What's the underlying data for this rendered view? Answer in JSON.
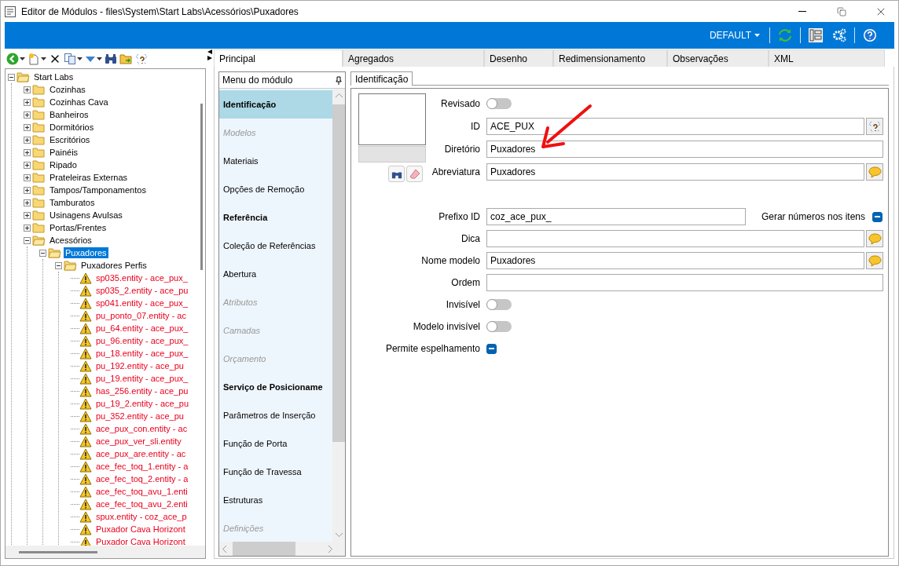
{
  "window": {
    "title": "Editor de Módulos - files\\System\\Start Labs\\Acessórios\\Puxadores"
  },
  "header": {
    "profile": "DEFAULT"
  },
  "tree": [
    {
      "label": "Start Labs",
      "kind": "folder",
      "expanded": true,
      "selected": false,
      "children": [
        {
          "label": "Cozinhas",
          "kind": "folder",
          "expanded": false,
          "selected": false
        },
        {
          "label": "Cozinhas Cava",
          "kind": "folder",
          "expanded": false,
          "selected": false
        },
        {
          "label": "Banheiros",
          "kind": "folder",
          "expanded": false,
          "selected": false
        },
        {
          "label": "Dormitórios",
          "kind": "folder",
          "expanded": false,
          "selected": false
        },
        {
          "label": "Escritórios",
          "kind": "folder",
          "expanded": false,
          "selected": false
        },
        {
          "label": "Painéis",
          "kind": "folder",
          "expanded": false,
          "selected": false
        },
        {
          "label": "Ripado",
          "kind": "folder",
          "expanded": false,
          "selected": false
        },
        {
          "label": "Prateleiras Externas",
          "kind": "folder",
          "expanded": false,
          "selected": false
        },
        {
          "label": "Tampos/Tamponamentos",
          "kind": "folder",
          "expanded": false,
          "selected": false
        },
        {
          "label": "Tamburatos",
          "kind": "folder",
          "expanded": false,
          "selected": false
        },
        {
          "label": "Usinagens Avulsas",
          "kind": "folder",
          "expanded": false,
          "selected": false
        },
        {
          "label": "Portas/Frentes",
          "kind": "folder",
          "expanded": false,
          "selected": false
        },
        {
          "label": "Acessórios",
          "kind": "folder",
          "expanded": true,
          "selected": false,
          "children": [
            {
              "label": "Puxadores",
              "kind": "folder",
              "expanded": true,
              "selected": true,
              "children": [
                {
                  "label": "Puxadores Perfis",
                  "kind": "folder",
                  "expanded": true,
                  "selected": false,
                  "children": [
                    {
                      "label": "sp035.entity - ace_pux_",
                      "kind": "warning",
                      "selected": false
                    },
                    {
                      "label": "sp035_2.entity - ace_pu",
                      "kind": "warning",
                      "selected": false
                    },
                    {
                      "label": "sp041.entity - ace_pux_",
                      "kind": "warning",
                      "selected": false
                    },
                    {
                      "label": "pu_ponto_07.entity - ac",
                      "kind": "warning",
                      "selected": false
                    },
                    {
                      "label": "pu_64.entity - ace_pux_",
                      "kind": "warning",
                      "selected": false
                    },
                    {
                      "label": "pu_96.entity - ace_pux_",
                      "kind": "warning",
                      "selected": false
                    },
                    {
                      "label": "pu_18.entity - ace_pux_",
                      "kind": "warning",
                      "selected": false
                    },
                    {
                      "label": "pu_192.entity - ace_pu",
                      "kind": "warning",
                      "selected": false
                    },
                    {
                      "label": "pu_19.entity - ace_pux_",
                      "kind": "warning",
                      "selected": false
                    },
                    {
                      "label": "has_256.entity - ace_pu",
                      "kind": "warning",
                      "selected": false
                    },
                    {
                      "label": "pu_19_2.entity - ace_pu",
                      "kind": "warning",
                      "selected": false
                    },
                    {
                      "label": "pu_352.entity - ace_pu",
                      "kind": "warning",
                      "selected": false
                    },
                    {
                      "label": "ace_pux_con.entity - ac",
                      "kind": "warning",
                      "selected": false
                    },
                    {
                      "label": "ace_pux_ver_sli.entity",
                      "kind": "warning",
                      "selected": false
                    },
                    {
                      "label": "ace_pux_are.entity - ac",
                      "kind": "warning",
                      "selected": false
                    },
                    {
                      "label": "ace_fec_toq_1.entity - a",
                      "kind": "warning",
                      "selected": false
                    },
                    {
                      "label": "ace_fec_toq_2.entity - a",
                      "kind": "warning",
                      "selected": false
                    },
                    {
                      "label": "ace_fec_toq_avu_1.enti",
                      "kind": "warning",
                      "selected": false
                    },
                    {
                      "label": "ace_fec_toq_avu_2.enti",
                      "kind": "warning",
                      "selected": false
                    },
                    {
                      "label": "spux.entity - coz_ace_p",
                      "kind": "warning",
                      "selected": false
                    },
                    {
                      "label": "Puxador Cava Horizont",
                      "kind": "warning",
                      "selected": false
                    },
                    {
                      "label": "Puxador Cava Horizont",
                      "kind": "warning",
                      "selected": false
                    }
                  ]
                }
              ]
            }
          ]
        }
      ]
    }
  ],
  "tabs": [
    {
      "label": "Principal",
      "selected": true
    },
    {
      "label": "Agregados",
      "selected": false
    },
    {
      "label": "Desenho",
      "selected": false
    },
    {
      "label": "Redimensionamento",
      "selected": false
    },
    {
      "label": "Observações",
      "selected": false
    },
    {
      "label": "XML",
      "selected": false
    }
  ],
  "module_menu": {
    "title": "Menu do módulo",
    "items": [
      {
        "label": "Identificação",
        "kind": "heading",
        "selected": true
      },
      {
        "label": "Modelos",
        "kind": "disabled",
        "selected": false
      },
      {
        "label": "Materiais",
        "kind": "item",
        "selected": false
      },
      {
        "label": "Opções de Remoção",
        "kind": "item",
        "selected": false
      },
      {
        "label": "Referência",
        "kind": "heading",
        "selected": false
      },
      {
        "label": "Coleção de Referências",
        "kind": "item",
        "selected": false
      },
      {
        "label": "Abertura",
        "kind": "item",
        "selected": false
      },
      {
        "label": "Atributos",
        "kind": "disabled",
        "selected": false
      },
      {
        "label": "Camadas",
        "kind": "disabled",
        "selected": false
      },
      {
        "label": "Orçamento",
        "kind": "disabled",
        "selected": false
      },
      {
        "label": "Serviço de Posicioname",
        "kind": "heading",
        "selected": false
      },
      {
        "label": "Parâmetros de Inserção",
        "kind": "item",
        "selected": false
      },
      {
        "label": "Função de Porta",
        "kind": "item",
        "selected": false
      },
      {
        "label": "Função de Travessa",
        "kind": "item",
        "selected": false
      },
      {
        "label": "Estruturas",
        "kind": "item",
        "selected": false
      },
      {
        "label": "Definições",
        "kind": "disabled",
        "selected": false
      }
    ]
  },
  "subtabs": [
    {
      "label": "Identificação",
      "selected": true
    }
  ],
  "form": [
    {
      "kind": "toggle",
      "label": "Revisado",
      "on": false
    },
    {
      "kind": "field",
      "label": "ID",
      "value": "ACE_PUX",
      "picker_button": true
    },
    {
      "kind": "field",
      "label": "Diretório",
      "value": "Puxadores"
    },
    {
      "kind": "field",
      "label": "Abreviatura",
      "value": "Puxadores",
      "comment_button": true
    },
    {
      "kind": "field_check",
      "label": "Prefixo ID",
      "value": "coz_ace_pux_",
      "check_label": "Gerar números nos itens",
      "indeterminate": true
    },
    {
      "kind": "field",
      "label": "Dica",
      "comment_button": true
    },
    {
      "kind": "field",
      "label": "Nome modelo",
      "value": "Puxadores",
      "comment_button": true
    },
    {
      "kind": "field",
      "label": "Ordem"
    },
    {
      "kind": "toggle",
      "label": "Invisível",
      "on": false
    },
    {
      "kind": "toggle",
      "label": "Modelo invisível",
      "on": false
    },
    {
      "kind": "checkbox",
      "label": "Permite espelhamento",
      "indeterminate": true
    }
  ]
}
